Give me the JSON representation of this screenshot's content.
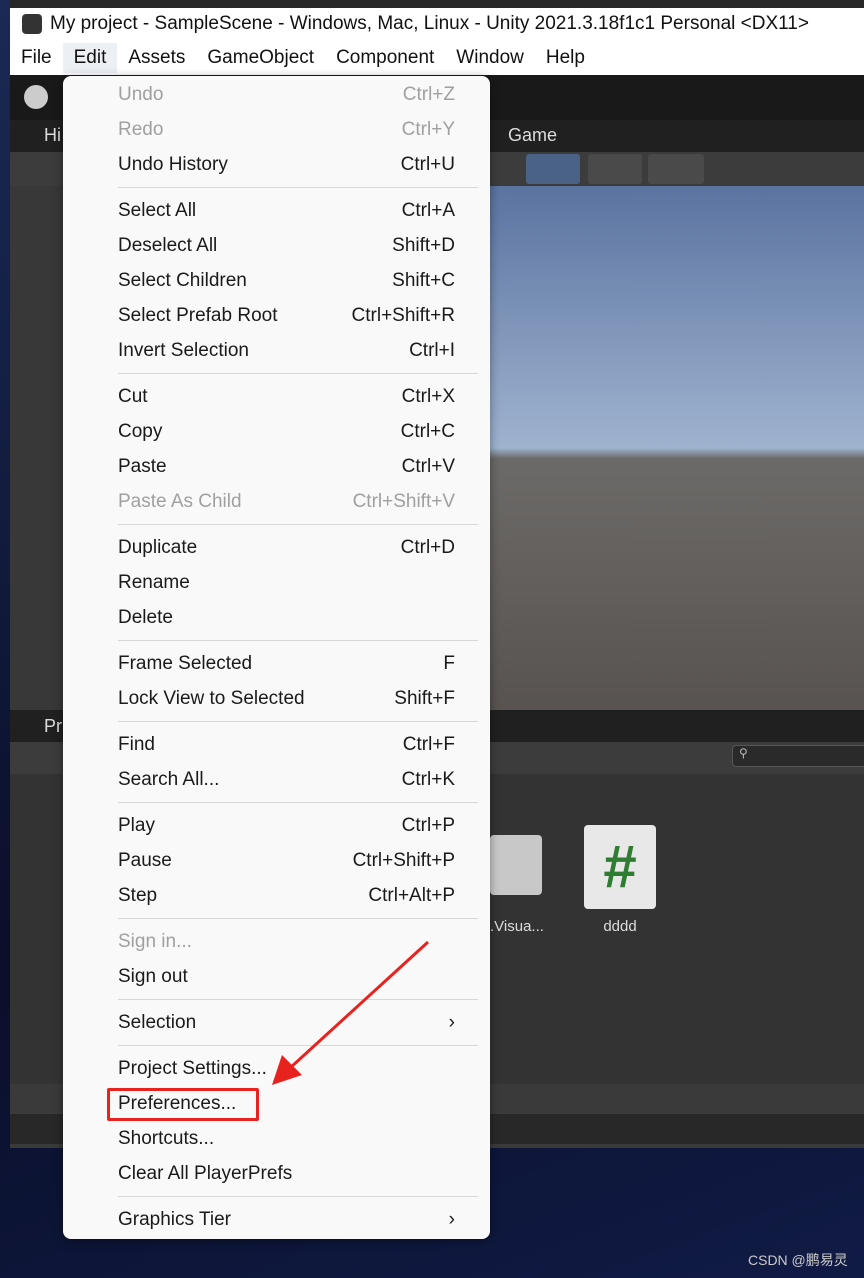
{
  "window": {
    "title": "My project - SampleScene - Windows, Mac, Linux - Unity 2021.3.18f1c1 Personal <DX11>"
  },
  "menubar": [
    "File",
    "Edit",
    "Assets",
    "GameObject",
    "Component",
    "Window",
    "Help"
  ],
  "active_menu": "Edit",
  "tabs": {
    "hierarchy": "Hi",
    "game": "Game",
    "project": "Pr"
  },
  "project": {
    "items": [
      {
        "label": ".Visua..."
      },
      {
        "label": "dddd",
        "icon": "csharp-script-icon"
      }
    ]
  },
  "edit_menu": [
    {
      "label": "Undo",
      "shortcut": "Ctrl+Z",
      "disabled": true
    },
    {
      "label": "Redo",
      "shortcut": "Ctrl+Y",
      "disabled": true
    },
    {
      "label": "Undo History",
      "shortcut": "Ctrl+U"
    },
    {
      "sep": true
    },
    {
      "label": "Select All",
      "shortcut": "Ctrl+A"
    },
    {
      "label": "Deselect All",
      "shortcut": "Shift+D"
    },
    {
      "label": "Select Children",
      "shortcut": "Shift+C"
    },
    {
      "label": "Select Prefab Root",
      "shortcut": "Ctrl+Shift+R"
    },
    {
      "label": "Invert Selection",
      "shortcut": "Ctrl+I"
    },
    {
      "sep": true
    },
    {
      "label": "Cut",
      "shortcut": "Ctrl+X"
    },
    {
      "label": "Copy",
      "shortcut": "Ctrl+C"
    },
    {
      "label": "Paste",
      "shortcut": "Ctrl+V"
    },
    {
      "label": "Paste As Child",
      "shortcut": "Ctrl+Shift+V",
      "disabled": true
    },
    {
      "sep": true
    },
    {
      "label": "Duplicate",
      "shortcut": "Ctrl+D"
    },
    {
      "label": "Rename",
      "shortcut": ""
    },
    {
      "label": "Delete",
      "shortcut": ""
    },
    {
      "sep": true
    },
    {
      "label": "Frame Selected",
      "shortcut": "F"
    },
    {
      "label": "Lock View to Selected",
      "shortcut": "Shift+F"
    },
    {
      "sep": true
    },
    {
      "label": "Find",
      "shortcut": "Ctrl+F"
    },
    {
      "label": "Search All...",
      "shortcut": "Ctrl+K"
    },
    {
      "sep": true
    },
    {
      "label": "Play",
      "shortcut": "Ctrl+P"
    },
    {
      "label": "Pause",
      "shortcut": "Ctrl+Shift+P"
    },
    {
      "label": "Step",
      "shortcut": "Ctrl+Alt+P"
    },
    {
      "sep": true
    },
    {
      "label": "Sign in...",
      "shortcut": "",
      "disabled": true
    },
    {
      "label": "Sign out",
      "shortcut": ""
    },
    {
      "sep": true
    },
    {
      "label": "Selection",
      "shortcut": "›",
      "submenu": true
    },
    {
      "sep": true
    },
    {
      "label": "Project Settings...",
      "shortcut": ""
    },
    {
      "label": "Preferences...",
      "shortcut": "",
      "highlighted": true
    },
    {
      "label": "Shortcuts...",
      "shortcut": ""
    },
    {
      "label": "Clear All PlayerPrefs",
      "shortcut": ""
    },
    {
      "sep": true
    },
    {
      "label": "Graphics Tier",
      "shortcut": "›",
      "submenu": true
    }
  ],
  "annotation": {
    "color": "#e8231f"
  },
  "watermark": "CSDN @鹏易灵"
}
